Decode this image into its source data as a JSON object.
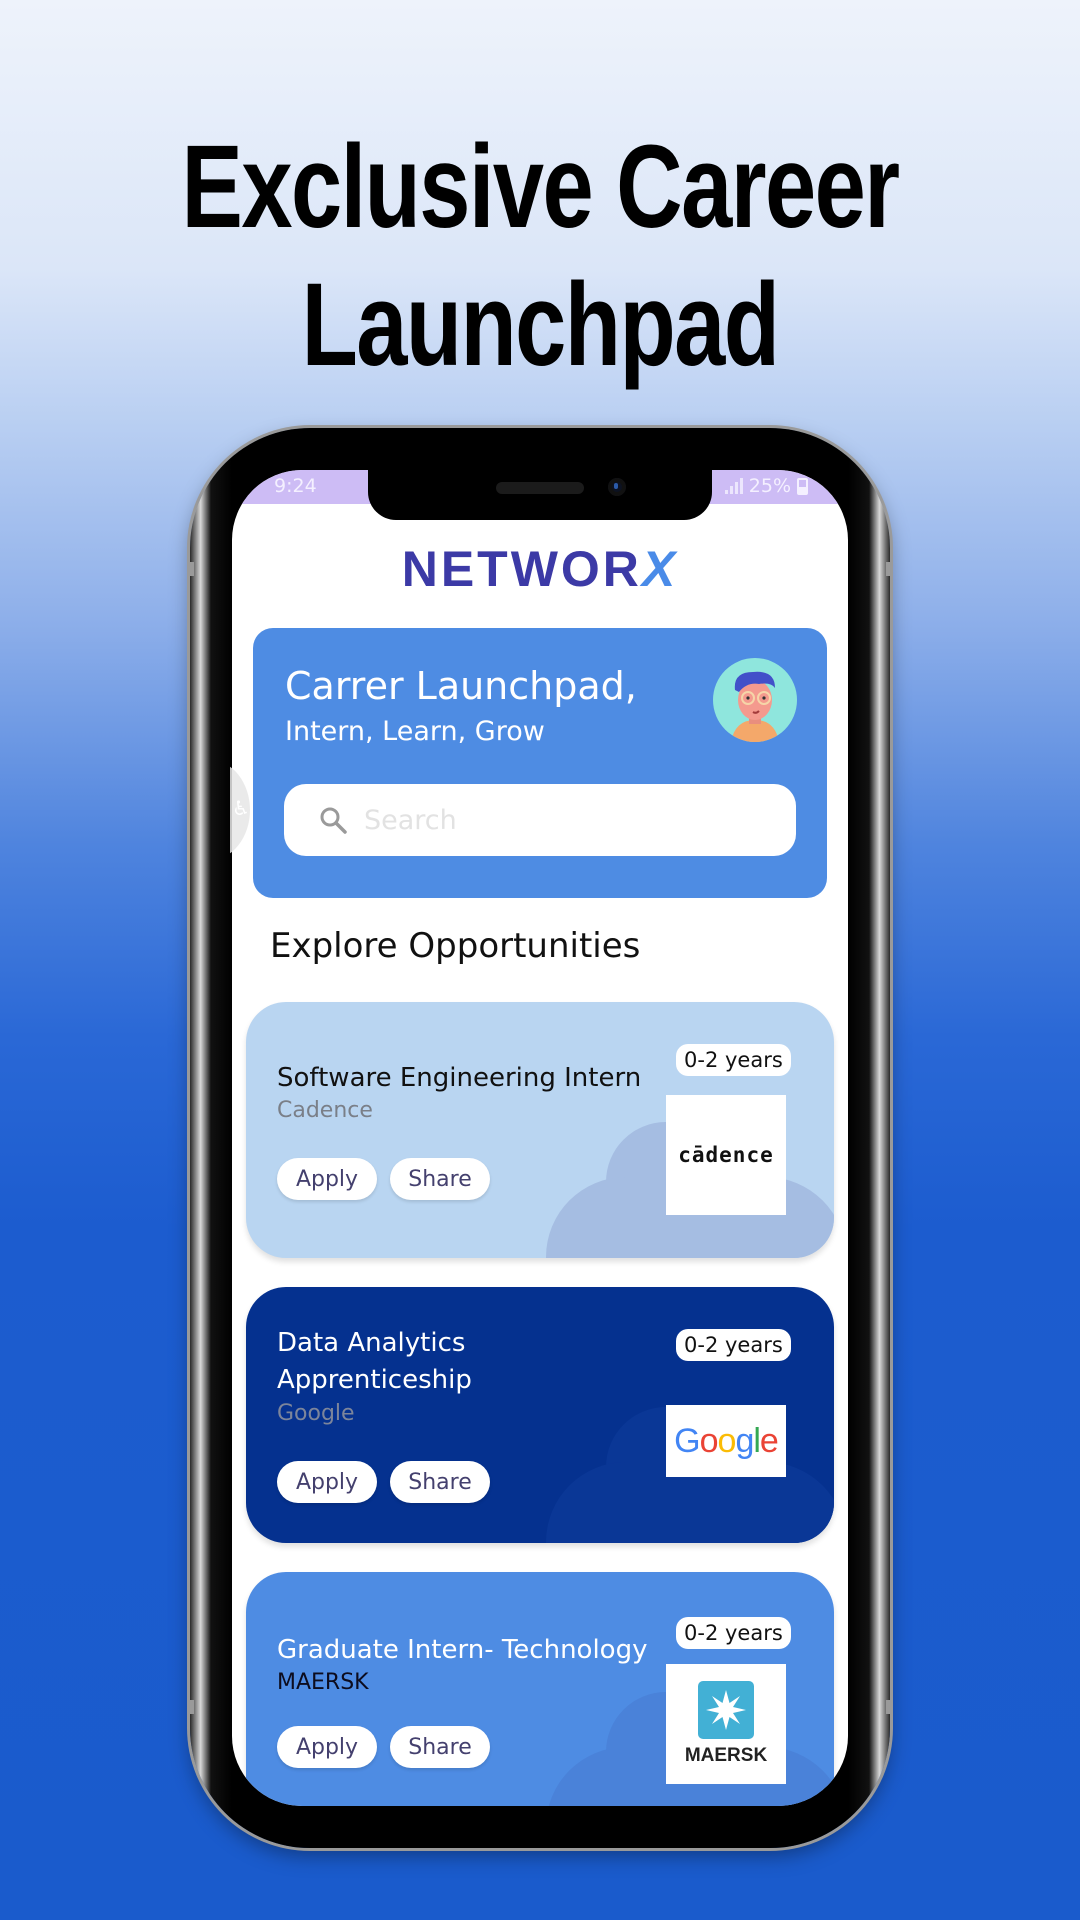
{
  "headline": {
    "line1": "Exclusive Career",
    "line2": "Launchpad"
  },
  "status_bar": {
    "time": "9:24",
    "battery": "25%",
    "icons": [
      "signal-icon",
      "battery-icon"
    ]
  },
  "app": {
    "logo_main": "NETWOR",
    "logo_accent": "X"
  },
  "hero": {
    "title": "Carrer Launchpad,",
    "subtitle": "Intern, Learn, Grow",
    "avatar_icon": "user-avatar",
    "search": {
      "placeholder": "Search",
      "value": "",
      "icon": "search-icon"
    }
  },
  "section": {
    "title": "Explore Opportunities"
  },
  "jobs": [
    {
      "title": "Software Engineering Intern",
      "company": "Cadence",
      "experience": "0-2 years",
      "logo_text": "cādence",
      "apply_label": "Apply",
      "share_label": "Share",
      "bg_color": "#b9d5f1",
      "title_color": "#111111",
      "company_color": "#7a7f88"
    },
    {
      "title": "Data Analytics Apprenticeship",
      "company": "Google",
      "experience": "0-2 years",
      "logo_text": "Google",
      "apply_label": "Apply",
      "share_label": "Share",
      "bg_color": "#05318f",
      "title_color": "#ffffff",
      "company_color": "#7c859b"
    },
    {
      "title": "Graduate Intern- Technology",
      "company": "MAERSK",
      "experience": "0-2 years",
      "logo_text": "MAERSK",
      "apply_label": "Apply",
      "share_label": "Share",
      "bg_color": "#4e8ce3",
      "title_color": "#ffffff",
      "company_color": "#0c0c1e"
    }
  ],
  "colors": {
    "accent": "#4e8ce3",
    "logo": "#3c3aa6",
    "logo_accent": "#4a8be8",
    "status_bar": "#cdbcf5",
    "maersk_blue": "#42b0d5"
  }
}
